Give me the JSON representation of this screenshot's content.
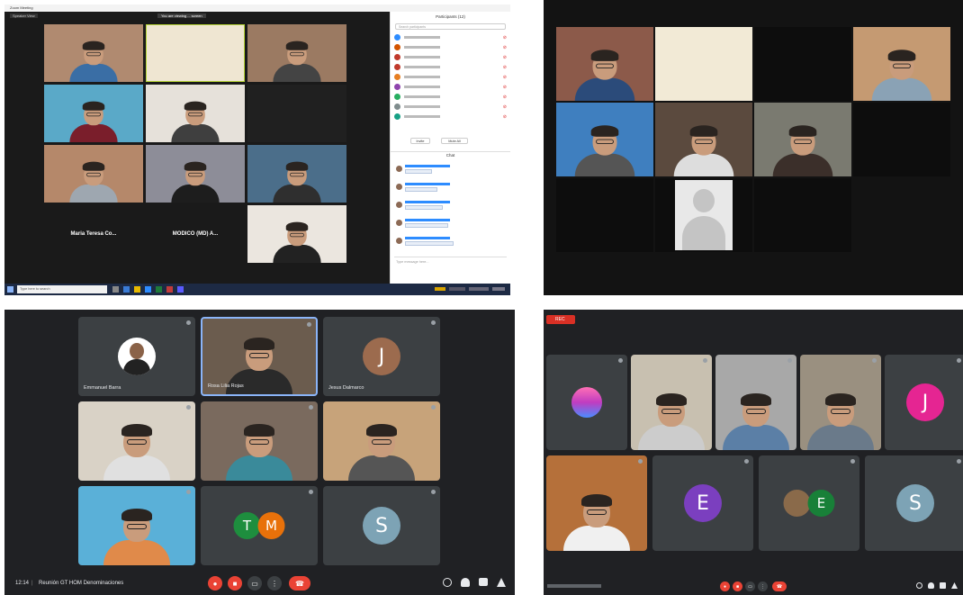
{
  "panel_tl": {
    "window_title": "Zoom Meeting",
    "view_label": "Speaker View",
    "recording_banner": "You are viewing ... screen",
    "tiles": [
      {
        "name": "",
        "bg": "#b08a70",
        "shirt": "#3a6ea5"
      },
      {
        "name": "",
        "bg": "#efe6d2",
        "shirt": ""
      },
      {
        "name": "",
        "bg": "#9b7a62",
        "shirt": "#444"
      },
      {
        "name": "",
        "bg": "#5aa9c8",
        "shirt": "#7a1e2b"
      },
      {
        "name": "",
        "bg": "#e6e1da",
        "shirt": "#3f3f3f"
      },
      {
        "name": "",
        "bg": "#202020",
        "shirt": ""
      },
      {
        "name": "",
        "bg": "#b5886a",
        "shirt": "#9ea7b0"
      },
      {
        "name": "",
        "bg": "#8d8d98",
        "shirt": "#1d1d1d"
      },
      {
        "name": "",
        "bg": "#4b6e8a",
        "shirt": "#2f2f2f"
      },
      {
        "name": "Maria Teresa Co...",
        "bg": "#1a1a1a",
        "shirt": ""
      },
      {
        "name": "MODICO (MD) A...",
        "bg": "#1a1a1a",
        "shirt": ""
      },
      {
        "name": "",
        "bg": "#ebe6df",
        "shirt": "#222"
      }
    ],
    "participants_title": "Participants (12)",
    "search_placeholder": "Search participants",
    "participant_rows": [
      {
        "color": "#2d8cff"
      },
      {
        "color": "#d35400"
      },
      {
        "color": "#c0392b"
      },
      {
        "color": "#c0392b"
      },
      {
        "color": "#e67e22"
      },
      {
        "color": "#8e44ad"
      },
      {
        "color": "#27ae60"
      },
      {
        "color": "#7f8c8d"
      },
      {
        "color": "#16a085"
      }
    ],
    "invite_label": "Invite",
    "mute_all_label": "Mute All",
    "chat_title": "Chat",
    "chat_messages": [
      "",
      "",
      "",
      "",
      ""
    ],
    "chat_input_placeholder": "Type message here...",
    "taskbar_search": "Type here to search"
  },
  "panel_tr": {
    "tiles": [
      {
        "bg": "#8c5a4a",
        "shirt": "#2b4b7a"
      },
      {
        "bg": "#f2ead6",
        "shirt": ""
      },
      {
        "bg": "#0d0d0d",
        "shirt": ""
      },
      {
        "bg": "#c59a72",
        "shirt": "#8aa2b5"
      },
      {
        "bg": "#3f7fbf",
        "shirt": "#555"
      },
      {
        "bg": "#5b4a3e",
        "shirt": "#ddd"
      },
      {
        "bg": "#7a7a70",
        "shirt": "#3b2f2a"
      },
      {
        "bg": "#0d0d0d",
        "shirt": ""
      },
      {
        "bg": "#0d0d0d",
        "shirt": ""
      },
      {
        "bg": "#eeeeee",
        "shirt": ""
      },
      {
        "bg": "#0d0d0d",
        "shirt": ""
      }
    ]
  },
  "panel_bl": {
    "tiles": [
      {
        "name": "Emmanuel Barra",
        "kind": "photo-avatar",
        "bg": "#3c4043"
      },
      {
        "name": "Rosa Lilia Rojas",
        "kind": "video",
        "bg": "#6b5c4e",
        "shirt": "#2a2a2a",
        "active": true
      },
      {
        "name": "Jesus Dalmarco",
        "kind": "letter",
        "letter": "J",
        "color": "#9c6b4e",
        "bg": "#3c4043"
      },
      {
        "name": "",
        "kind": "video",
        "bg": "#d9d2c6",
        "shirt": "#e0e0e0"
      },
      {
        "name": "",
        "kind": "video",
        "bg": "#7a6a5e",
        "shirt": "#3a8a9a"
      },
      {
        "name": "",
        "kind": "video",
        "bg": "#c7a37a",
        "shirt": "#555"
      },
      {
        "name": "",
        "kind": "video",
        "bg": "#5ab0d8",
        "shirt": "#e08a4a"
      },
      {
        "name": "",
        "kind": "pair",
        "letters": [
          "T",
          "M"
        ],
        "colors": [
          "#1e8e3e",
          "#e8710a"
        ],
        "bg": "#3c4043"
      },
      {
        "name": "",
        "kind": "letter",
        "letter": "S",
        "color": "#7da3b5",
        "bg": "#3c4043"
      }
    ],
    "time": "12:14",
    "meeting_title": "Reunión GT HOM Denominaciones",
    "controls": [
      "mic-off",
      "cam-off",
      "cc",
      "more",
      "end"
    ]
  },
  "panel_br": {
    "rec_label": "REC",
    "tiles": [
      {
        "name": "",
        "kind": "logo",
        "bg": "#3c4043"
      },
      {
        "name": "",
        "kind": "video",
        "bg": "#c8c0b0",
        "shirt": "#ccc"
      },
      {
        "name": "",
        "kind": "video",
        "bg": "#a8a8a8",
        "shirt": "#5b7fa6"
      },
      {
        "name": "",
        "kind": "video",
        "bg": "#9a9080",
        "shirt": "#6a7a8a"
      },
      {
        "name": "",
        "kind": "letter",
        "letter": "J",
        "color": "#e52592",
        "bg": "#3c4043"
      },
      {
        "name": "",
        "kind": "video",
        "bg": "#b5703a",
        "shirt": "#f0f0f0"
      },
      {
        "name": "",
        "kind": "letter",
        "letter": "E",
        "color": "#7b3fbf",
        "bg": "#3c4043"
      },
      {
        "name": "",
        "kind": "pair",
        "letters": [
          "",
          "E"
        ],
        "colors": [
          "#8a6a4a",
          "#188038"
        ],
        "bg": "#3c4043"
      },
      {
        "name": "",
        "kind": "letter",
        "letter": "S",
        "color": "#7da3b5",
        "bg": "#3c4043"
      }
    ],
    "controls": [
      "mic-off",
      "cam-off",
      "cc",
      "more",
      "end"
    ]
  }
}
